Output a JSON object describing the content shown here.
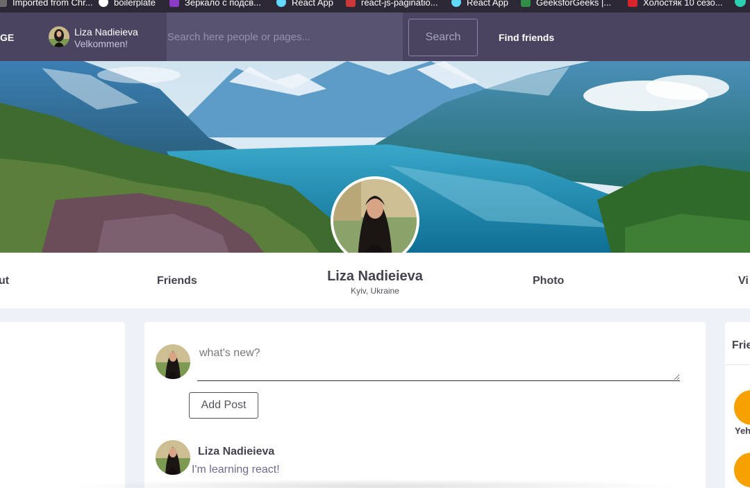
{
  "bookmarks": [
    {
      "label": "Imported from Chr...",
      "icon": "folder-icon",
      "color": "#6b6b6b"
    },
    {
      "label": "boilerplate",
      "icon": "github-icon",
      "color": "#ffffff"
    },
    {
      "label": "Зеркало с подсв...",
      "icon": "bookmark-purple-icon",
      "color": "#8a3cc7"
    },
    {
      "label": "React App",
      "icon": "react-icon",
      "color": "#61dafb"
    },
    {
      "label": "react-js-paginatio...",
      "icon": "npm-icon",
      "color": "#cb3837"
    },
    {
      "label": "React App",
      "icon": "react-icon",
      "color": "#61dafb"
    },
    {
      "label": "GeeksforGeeks |...",
      "icon": "gfg-icon",
      "color": "#2f8d46"
    },
    {
      "label": "Холостяк 10 сезо...",
      "icon": "tv-icon",
      "color": "#d8242a"
    }
  ],
  "header": {
    "brand": "GE",
    "user_name": "Liza Nadieieva",
    "greeting": "Velkommen!",
    "search_placeholder": "Search here people or pages...",
    "search_button": "Search",
    "find_friends": "Find friends"
  },
  "profile": {
    "name": "Liza Nadieieva",
    "location": "Kyiv, Ukraine",
    "nav": [
      "ut",
      "Friends",
      "Photo",
      "Vi"
    ]
  },
  "composer": {
    "placeholder": "what's new?",
    "add_post_label": "Add Post"
  },
  "post": {
    "author": "Liza Nadieieva",
    "text": "I'm learning react!"
  },
  "friends_panel": {
    "title": "Frie",
    "first_friend": "Yeh"
  },
  "colors": {
    "header_bg": "#4a4460",
    "page_bg": "#eef1f8",
    "friend_avatar": "#f7a100",
    "text_dark": "#45424f"
  }
}
